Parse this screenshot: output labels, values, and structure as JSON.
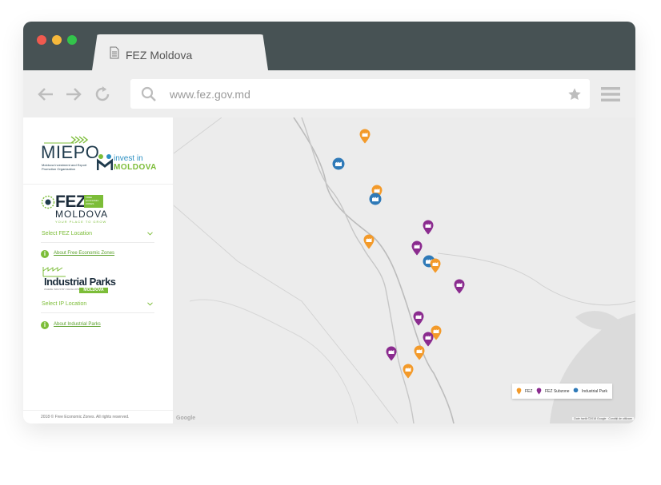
{
  "browser": {
    "tab_title": "FEZ Moldova",
    "url": "www.fez.gov.md"
  },
  "sidebar": {
    "miepo": {
      "name": "MIEPO",
      "subtitle": "Moldova Investment and Export Promotion Organization"
    },
    "invest": {
      "line1": "invest in",
      "line2": "MOLDOVA"
    },
    "fez_logo": {
      "word": "FEZ",
      "box_text": "FREE ECONOMIC ZONES",
      "country": "MOLDOVA",
      "tagline": "YOUR PLACE TO GROW"
    },
    "fez_select_label": "Select FEZ Location",
    "fez_about_link": "About Free Economic Zones",
    "ip_logo": {
      "word": "Industrial Parks",
      "sub": "WHERE INDUSTRY DEVELOPS",
      "badge": "MOLDOVA"
    },
    "ip_select_label": "Select IP Location",
    "ip_about_link": "About Industrial Parks",
    "footer": "2018 © Free Economic Zones. All rights reserved."
  },
  "map": {
    "markers": [
      {
        "type": "fez"
      },
      {
        "type": "industrial-park"
      },
      {
        "type": "fez"
      },
      {
        "type": "industrial-park"
      },
      {
        "type": "fez-subzone"
      },
      {
        "type": "fez"
      },
      {
        "type": "fez-subzone"
      },
      {
        "type": "industrial-park"
      },
      {
        "type": "fez"
      },
      {
        "type": "fez-subzone"
      },
      {
        "type": "fez-subzone"
      },
      {
        "type": "fez"
      },
      {
        "type": "fez-subzone"
      },
      {
        "type": "fez"
      },
      {
        "type": "fez-subzone"
      },
      {
        "type": "fez"
      }
    ],
    "legend": {
      "fez": "FEZ",
      "subzone": "FEZ Subzone",
      "ip": "Industrial Park"
    },
    "google_label": "Google",
    "attribution": "Date hartă ©2018 Google · Condiții de utilizare"
  },
  "colors": {
    "fez": "#f39a2a",
    "subzone": "#8b2c8f",
    "ip": "#2f7ab8",
    "brand_green": "#7cbd38"
  }
}
